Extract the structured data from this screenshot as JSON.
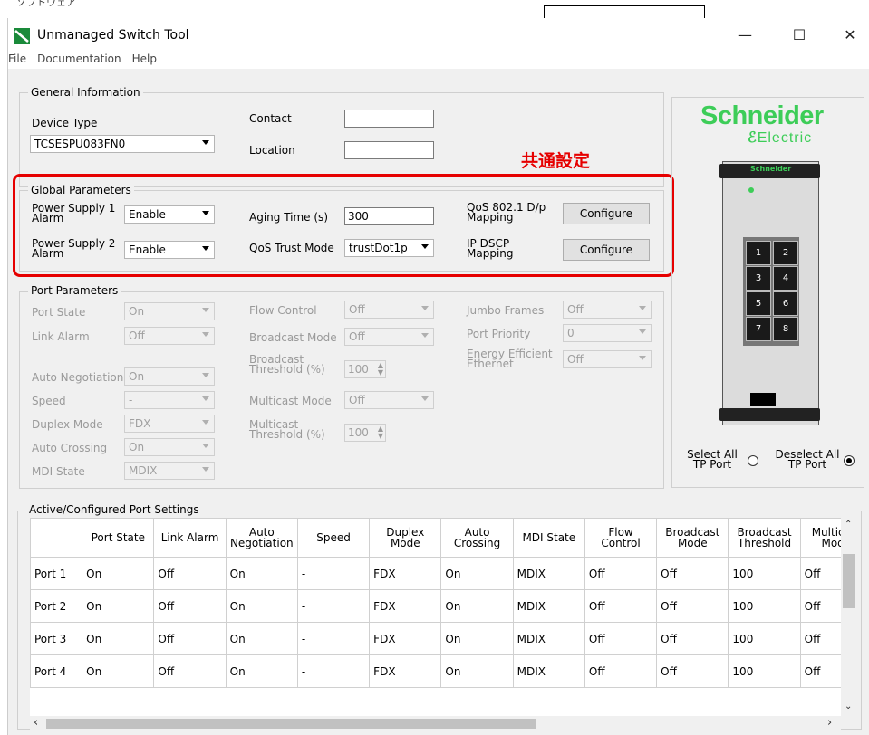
{
  "top_fragment": {
    "text": "ソフトウェア"
  },
  "window": {
    "title": "Unmanaged Switch Tool",
    "controls": {
      "minimize": "—",
      "maximize": "☐",
      "close": "✕"
    }
  },
  "menu": {
    "items": [
      "File",
      "Documentation",
      "Help"
    ]
  },
  "general": {
    "title": "General Information",
    "device_type_label": "Device Type",
    "device_type_value": "TCSESPU083FN0",
    "contact_label": "Contact",
    "contact_value": "",
    "location_label": "Location",
    "location_value": ""
  },
  "annotation": {
    "text": "共通設定",
    "color": "#e60000"
  },
  "global": {
    "title": "Global Parameters",
    "ps1_label": "Power Supply 1 Alarm",
    "ps1_value": "Enable",
    "ps2_label": "Power Supply 2 Alarm",
    "ps2_value": "Enable",
    "aging_label": "Aging Time (s)",
    "aging_value": "300",
    "qos_trust_label": "QoS Trust Mode",
    "qos_trust_value": "trustDot1p",
    "qos_map_label": "QoS 802.1 D/p Mapping",
    "ipdscp_label": "IP DSCP Mapping",
    "configure_label": "Configure"
  },
  "port": {
    "title": "Port Parameters",
    "port_state_label": "Port State",
    "port_state_value": "On",
    "link_alarm_label": "Link Alarm",
    "link_alarm_value": "Off",
    "auto_neg_label": "Auto Negotiation",
    "auto_neg_value": "On",
    "speed_label": "Speed",
    "speed_value": "-",
    "duplex_label": "Duplex Mode",
    "duplex_value": "FDX",
    "auto_cross_label": "Auto Crossing",
    "auto_cross_value": "On",
    "mdi_label": "MDI State",
    "mdi_value": "MDIX",
    "flow_label": "Flow Control",
    "flow_value": "Off",
    "bcast_mode_label": "Broadcast Mode",
    "bcast_mode_value": "Off",
    "bcast_thr_label": "Broadcast Threshold (%)",
    "bcast_thr_value": "100",
    "mcast_mode_label": "Multicast Mode",
    "mcast_mode_value": "Off",
    "mcast_thr_label": "Multicast Threshold (%)",
    "mcast_thr_value": "100",
    "jumbo_label": "Jumbo Frames",
    "jumbo_value": "Off",
    "priority_label": "Port Priority",
    "priority_value": "0",
    "eee_label": "Energy Efficient Ethernet",
    "eee_value": "Off"
  },
  "brand": {
    "name": "Schneider",
    "sub": "Electric",
    "color": "#3dcd58"
  },
  "device_image": {
    "brand_mark": "Schneider",
    "port_numbers": [
      "1",
      "2",
      "3",
      "4",
      "5",
      "6",
      "7",
      "8"
    ]
  },
  "selection": {
    "select_all_label": "Select All TP Port",
    "deselect_all_label": "Deselect All TP Port",
    "select_all_checked": false,
    "deselect_all_checked": true
  },
  "table": {
    "title": "Active/Configured Port Settings",
    "columns": [
      "",
      "Port State",
      "Link Alarm",
      "Auto Negotiation",
      "Speed",
      "Duplex Mode",
      "Auto Crossing",
      "MDI State",
      "Flow Control",
      "Broadcast Mode",
      "Broadcast Threshold",
      "Multicast Mode"
    ],
    "rows": [
      [
        "Port 1",
        "On",
        "Off",
        "On",
        "-",
        "FDX",
        "On",
        "MDIX",
        "Off",
        "Off",
        "100",
        "Off"
      ],
      [
        "Port 2",
        "On",
        "Off",
        "On",
        "-",
        "FDX",
        "On",
        "MDIX",
        "Off",
        "Off",
        "100",
        "Off"
      ],
      [
        "Port 3",
        "On",
        "Off",
        "On",
        "-",
        "FDX",
        "On",
        "MDIX",
        "Off",
        "Off",
        "100",
        "Off"
      ],
      [
        "Port 4",
        "On",
        "Off",
        "On",
        "-",
        "FDX",
        "On",
        "MDIX",
        "Off",
        "Off",
        "100",
        "Off"
      ]
    ]
  }
}
